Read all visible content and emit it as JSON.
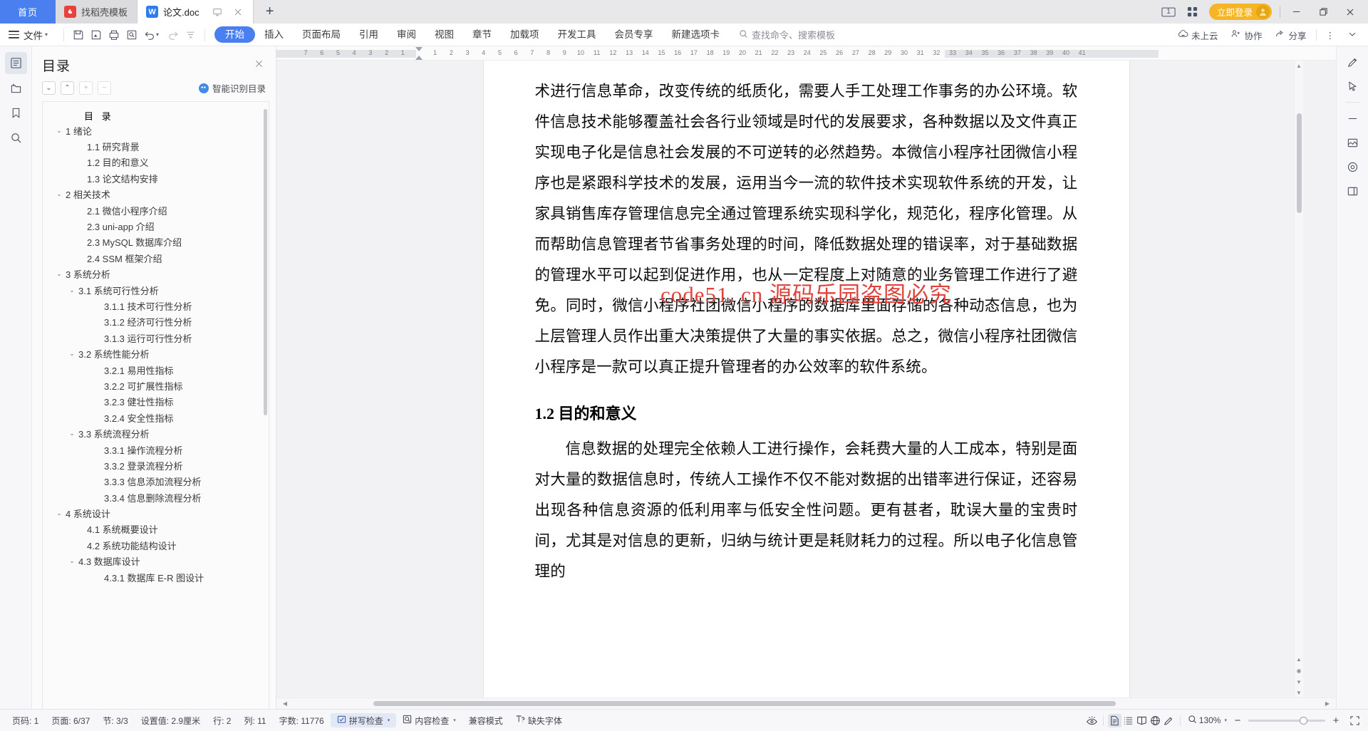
{
  "tabbar": {
    "home_label": "首页",
    "tabs": [
      {
        "label": "找稻壳模板",
        "icon": "daoke-icon",
        "icon_text": "W",
        "active": false
      },
      {
        "label": "论文.doc",
        "icon": "wps-writer-icon",
        "icon_text": "W",
        "active": true
      }
    ],
    "actions": {
      "present": "present-icon",
      "close": "close-icon",
      "newtab": "+"
    },
    "right": {
      "window_count": "1",
      "grid": "apps-grid-icon",
      "login_label": "立即登录",
      "minimize": "—",
      "maximize": "❐",
      "close": "✕"
    }
  },
  "ribbon": {
    "file_label": "文件",
    "quick_icons": [
      "save-icon",
      "save-cloud-icon",
      "print-icon",
      "print-preview-icon",
      "undo-icon",
      "redo-icon",
      "customize-icon"
    ],
    "tabs": [
      {
        "label": "开始",
        "active": true
      },
      {
        "label": "插入",
        "active": false
      },
      {
        "label": "页面布局",
        "active": false
      },
      {
        "label": "引用",
        "active": false
      },
      {
        "label": "审阅",
        "active": false
      },
      {
        "label": "视图",
        "active": false
      },
      {
        "label": "章节",
        "active": false
      },
      {
        "label": "加载项",
        "active": false
      },
      {
        "label": "开发工具",
        "active": false
      },
      {
        "label": "会员专享",
        "active": false
      },
      {
        "label": "新建选项卡",
        "active": false
      }
    ],
    "search_placeholder": "查找命令、搜索模板",
    "right_buttons": [
      {
        "label": "未上云",
        "icon": "cloud-icon"
      },
      {
        "label": "协作",
        "icon": "collaborate-icon"
      },
      {
        "label": "分享",
        "icon": "share-icon"
      }
    ],
    "more": "⋮",
    "collapse": "chevron-down-icon"
  },
  "left_rail": [
    {
      "name": "sidebar-item-outline",
      "icon": "outline-icon",
      "active": true
    },
    {
      "name": "sidebar-item-files",
      "icon": "folder-icon",
      "active": false
    },
    {
      "name": "sidebar-item-bookmark",
      "icon": "bookmark-icon",
      "active": false
    },
    {
      "name": "sidebar-item-search",
      "icon": "search-icon",
      "active": false
    }
  ],
  "navpane": {
    "title": "目录",
    "close_icon": "close-icon",
    "tools": [
      {
        "name": "expand-all-button",
        "glyph": "⌄",
        "pale": false
      },
      {
        "name": "collapse-all-button",
        "glyph": "⌃",
        "pale": false
      },
      {
        "name": "increase-level-button",
        "glyph": "+",
        "pale": true
      },
      {
        "name": "decrease-level-button",
        "glyph": "−",
        "pale": true
      }
    ],
    "smart_label": "智能识别目录",
    "toc_heading": "目  录",
    "toc": [
      {
        "label": "1  绪论",
        "level": 1,
        "chev": "⌄"
      },
      {
        "label": "1.1  研究背景",
        "level": 2,
        "chev": ""
      },
      {
        "label": "1.2  目的和意义",
        "level": 2,
        "chev": ""
      },
      {
        "label": "1.3  论文结构安排",
        "level": 2,
        "chev": ""
      },
      {
        "label": "2  相关技术",
        "level": 1,
        "chev": "⌄"
      },
      {
        "label": "2.1  微信小程序介绍",
        "level": 2,
        "chev": ""
      },
      {
        "label": "2.3  uni-app 介绍",
        "level": 2,
        "chev": ""
      },
      {
        "label": "2.3  MySQL 数据库介绍",
        "level": 2,
        "chev": ""
      },
      {
        "label": "2.4 SSM 框架介绍",
        "level": 2,
        "chev": ""
      },
      {
        "label": "3  系统分析",
        "level": 1,
        "chev": "⌄"
      },
      {
        "label": "3.1  系统可行性分析",
        "level": 2,
        "chev": "⌄"
      },
      {
        "label": "3.1.1  技术可行性分析",
        "level": 3,
        "chev": ""
      },
      {
        "label": "3.1.2  经济可行性分析",
        "level": 3,
        "chev": ""
      },
      {
        "label": "3.1.3  运行可行性分析",
        "level": 3,
        "chev": ""
      },
      {
        "label": "3.2  系统性能分析",
        "level": 2,
        "chev": "⌄"
      },
      {
        "label": "3.2.1  易用性指标",
        "level": 3,
        "chev": ""
      },
      {
        "label": "3.2.2  可扩展性指标",
        "level": 3,
        "chev": ""
      },
      {
        "label": "3.2.3  健壮性指标",
        "level": 3,
        "chev": ""
      },
      {
        "label": "3.2.4  安全性指标",
        "level": 3,
        "chev": ""
      },
      {
        "label": "3.3  系统流程分析",
        "level": 2,
        "chev": "⌄"
      },
      {
        "label": "3.3.1  操作流程分析",
        "level": 3,
        "chev": ""
      },
      {
        "label": "3.3.2  登录流程分析",
        "level": 3,
        "chev": ""
      },
      {
        "label": "3.3.3  信息添加流程分析",
        "level": 3,
        "chev": ""
      },
      {
        "label": "3.3.4  信息删除流程分析",
        "level": 3,
        "chev": ""
      },
      {
        "label": "4  系统设计",
        "level": 1,
        "chev": "⌄"
      },
      {
        "label": "4.1  系统概要设计",
        "level": 2,
        "chev": ""
      },
      {
        "label": "4.2  系统功能结构设计",
        "level": 2,
        "chev": ""
      },
      {
        "label": "4.3  数据库设计",
        "level": 2,
        "chev": "⌄"
      },
      {
        "label": "4.3.1  数据库 E-R 图设计",
        "level": 3,
        "chev": ""
      }
    ]
  },
  "ruler": {
    "left_numbers": [
      "7",
      "6",
      "5",
      "4",
      "3",
      "2",
      "1"
    ],
    "right_numbers": [
      "1",
      "2",
      "3",
      "4",
      "5",
      "6",
      "7",
      "8",
      "9",
      "10",
      "11",
      "12",
      "13",
      "14",
      "15",
      "16",
      "17",
      "18",
      "19",
      "20",
      "21",
      "22",
      "23",
      "24",
      "25",
      "26",
      "27",
      "28",
      "29",
      "30",
      "31",
      "32",
      "33",
      "34",
      "35",
      "36",
      "37",
      "38",
      "39",
      "40",
      "41"
    ]
  },
  "document": {
    "paragraphs": [
      "术进行信息革命，改变传统的纸质化，需要人手工处理工作事务的办公环境。软件信息技术能够覆盖社会各行业领域是时代的发展要求，各种数据以及文件真正实现电子化是信息社会发展的不可逆转的必然趋势。本微信小程序社团微信小程序也是紧跟科学技术的发展，运用当今一流的软件技术实现软件系统的开发，让家具销售库存管理信息完全通过管理系统实现科学化，规范化，程序化管理。从而帮助信息管理者节省事务处理的时间，降低数据处理的错误率，对于基础数据的管理水平可以起到促进作用，也从一定程度上对随意的业务管理工作进行了避免。同时，微信小程序社团微信小程序的数据库里面存储的各种动态信息，也为上层管理人员作出重大决策提供了大量的事实依据。总之，微信小程序社团微信小程序是一款可以真正提升管理者的办公效率的软件系统。"
    ],
    "heading": "1.2  目的和意义",
    "paragraph2": "信息数据的处理完全依赖人工进行操作，会耗费大量的人工成本，特别是面对大量的数据信息时，传统人工操作不仅不能对数据的出错率进行保证，还容易出现各种信息资源的低利用率与低安全性问题。更有甚者，耽误大量的宝贵时间，尤其是对信息的更新，归纳与统计更是耗财耗力的过程。所以电子化信息管理的",
    "watermark": "code51. cn  源码乐园盗图必究"
  },
  "right_rail": [
    {
      "name": "tool-pen",
      "icon": "pen-icon"
    },
    {
      "name": "tool-cursor",
      "icon": "cursor-icon"
    },
    {
      "name": "tool-divider",
      "icon": "divider-icon"
    },
    {
      "name": "tool-image",
      "icon": "image-icon"
    },
    {
      "name": "tool-target",
      "icon": "target-icon"
    },
    {
      "name": "tool-layout",
      "icon": "layout-icon"
    }
  ],
  "status": {
    "page_no_label": "页码: 1",
    "page_label": "页面: 6/37",
    "section_label": "节: 3/3",
    "setting_label": "设置值: 2.9厘米",
    "row_label": "行: 2",
    "col_label": "列: 11",
    "word_count_label": "字数: 11776",
    "spellcheck_label": "拼写检查",
    "contentcheck_label": "内容检查",
    "compat_label": "兼容模式",
    "missingfont_label": "缺失字体",
    "view_icons": [
      "eye-icon",
      "page-view-icon",
      "outline-view-icon",
      "reading-view-icon",
      "web-view-icon",
      "edit-view-icon"
    ],
    "zoom_minus": "−",
    "zoom_plus": "+",
    "zoom_value": "130%",
    "fullscreen_icon": "fullscreen-icon"
  },
  "colors": {
    "accent": "#4a7ff0",
    "login": "#f5b625",
    "watermark": "#e0443c",
    "tab_bg": "#e8e8ea"
  }
}
